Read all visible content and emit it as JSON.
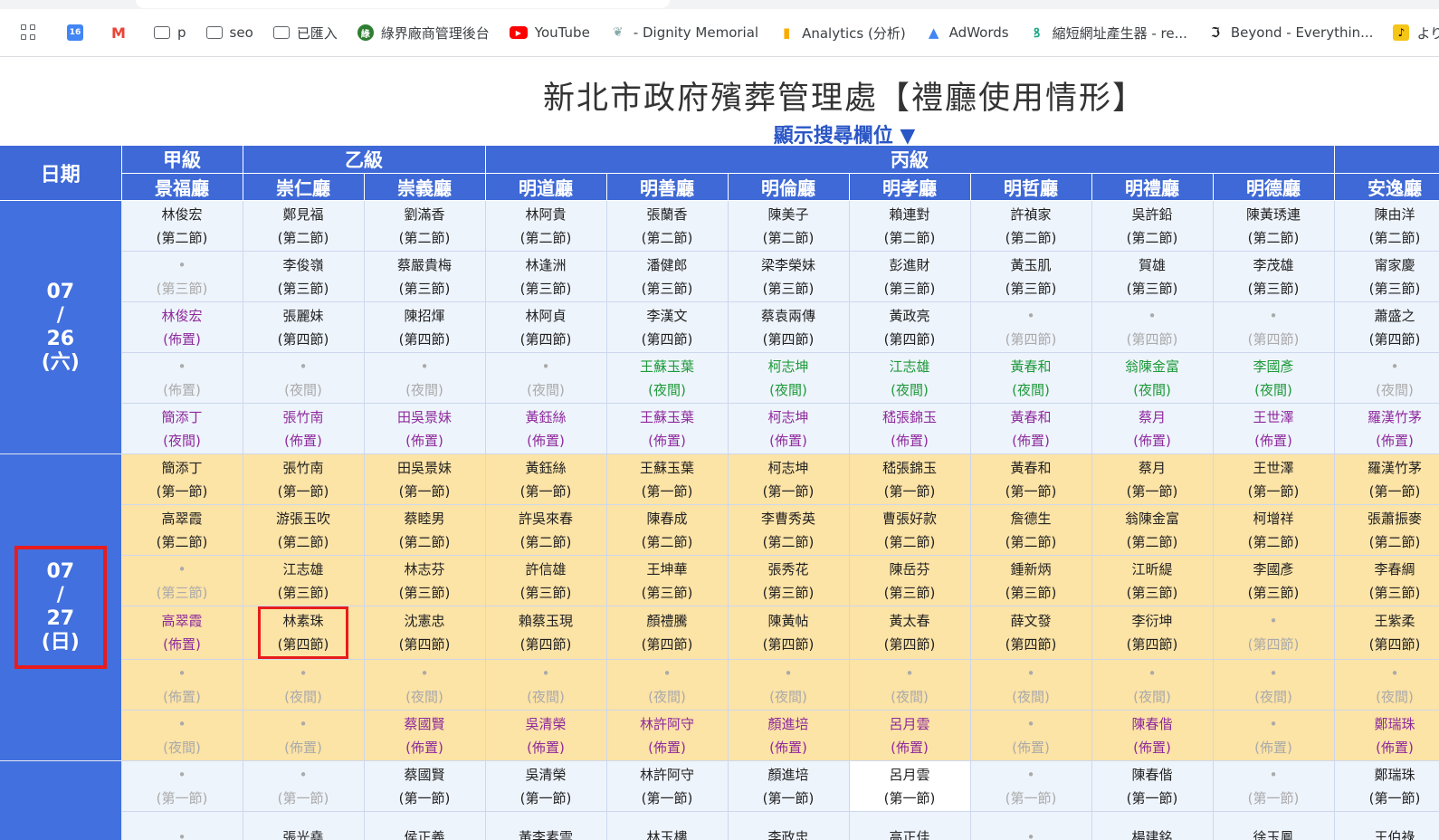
{
  "bookmarks": [
    {
      "label": "",
      "icon": "calendar-icon"
    },
    {
      "label": "",
      "icon": "gmail-icon"
    },
    {
      "label": "p",
      "icon": "folder-icon"
    },
    {
      "label": "seo",
      "icon": "folder-icon"
    },
    {
      "label": "已匯入",
      "icon": "folder-icon"
    },
    {
      "label": "綠界廠商管理後台",
      "icon": "ecpay-icon"
    },
    {
      "label": "YouTube",
      "icon": "youtube-icon"
    },
    {
      "label": "- Dignity Memorial",
      "icon": "leaf-icon"
    },
    {
      "label": "Analytics (分析)",
      "icon": "analytics-icon"
    },
    {
      "label": "AdWords",
      "icon": "adwords-icon"
    },
    {
      "label": "縮短網址產生器 - re...",
      "icon": "link-icon"
    },
    {
      "label": "Beyond - Everythin...",
      "icon": "beyond-icon"
    },
    {
      "label": "よりそ",
      "icon": "yorisou-icon"
    }
  ],
  "page": {
    "title": "新北市政府殯葬管理處【禮廳使用情形】",
    "search_toggle": "顯示搜尋欄位 ▼"
  },
  "table": {
    "date_header": "日期",
    "grades": [
      {
        "label": "甲級",
        "span": 1
      },
      {
        "label": "乙級",
        "span": 2
      },
      {
        "label": "丙級",
        "span": 7
      },
      {
        "label": "",
        "span": 1
      }
    ],
    "halls": [
      "景福廳",
      "崇仁廳",
      "崇義廳",
      "明道廳",
      "明善廳",
      "明倫廳",
      "明孝廳",
      "明哲廳",
      "明禮廳",
      "明德廳",
      "安逸廳"
    ],
    "days": [
      {
        "date_lines": [
          "07",
          "/",
          "26",
          "(六)"
        ],
        "theme": "blue",
        "rows": [
          [
            [
              "林俊宏",
              "(第二節)",
              "n"
            ],
            [
              "鄭見福",
              "(第二節)",
              "n"
            ],
            [
              "劉滿香",
              "(第二節)",
              "n"
            ],
            [
              "林阿貴",
              "(第二節)",
              "n"
            ],
            [
              "張蘭香",
              "(第二節)",
              "n"
            ],
            [
              "陳美子",
              "(第二節)",
              "n"
            ],
            [
              "賴連對",
              "(第二節)",
              "n"
            ],
            [
              "許禎家",
              "(第二節)",
              "n"
            ],
            [
              "吳許鉛",
              "(第二節)",
              "n"
            ],
            [
              "陳黃琇連",
              "(第二節)",
              "n"
            ],
            [
              "陳由洋",
              "(第二節)",
              "n"
            ]
          ],
          [
            [
              "•",
              "(第三節)",
              "e"
            ],
            [
              "李俊嶺",
              "(第三節)",
              "n"
            ],
            [
              "蔡嚴貴梅",
              "(第三節)",
              "n"
            ],
            [
              "林逢洲",
              "(第三節)",
              "n"
            ],
            [
              "潘健郎",
              "(第三節)",
              "n"
            ],
            [
              "梁李榮妹",
              "(第三節)",
              "n"
            ],
            [
              "彭進財",
              "(第三節)",
              "n"
            ],
            [
              "黃玉肌",
              "(第三節)",
              "n"
            ],
            [
              "賀雄",
              "(第三節)",
              "n"
            ],
            [
              "李茂雄",
              "(第三節)",
              "n"
            ],
            [
              "甯家慶",
              "(第三節)",
              "n"
            ]
          ],
          [
            [
              "林俊宏",
              "(佈置)",
              "p"
            ],
            [
              "張麗妹",
              "(第四節)",
              "n"
            ],
            [
              "陳招煇",
              "(第四節)",
              "n"
            ],
            [
              "林阿貞",
              "(第四節)",
              "n"
            ],
            [
              "李漢文",
              "(第四節)",
              "n"
            ],
            [
              "蔡袁兩傳",
              "(第四節)",
              "n"
            ],
            [
              "黃政亮",
              "(第四節)",
              "n"
            ],
            [
              "•",
              "(第四節)",
              "e"
            ],
            [
              "•",
              "(第四節)",
              "e"
            ],
            [
              "•",
              "(第四節)",
              "e"
            ],
            [
              "蕭盛之",
              "(第四節)",
              "n"
            ]
          ],
          [
            [
              "•",
              "(佈置)",
              "e"
            ],
            [
              "•",
              "(夜間)",
              "e"
            ],
            [
              "•",
              "(夜間)",
              "e"
            ],
            [
              "•",
              "(夜間)",
              "e"
            ],
            [
              "王蘇玉葉",
              "(夜間)",
              "g"
            ],
            [
              "柯志坤",
              "(夜間)",
              "g"
            ],
            [
              "江志雄",
              "(夜間)",
              "g"
            ],
            [
              "黃春和",
              "(夜間)",
              "g"
            ],
            [
              "翁陳金富",
              "(夜間)",
              "g"
            ],
            [
              "李國彥",
              "(夜間)",
              "g"
            ],
            [
              "•",
              "(夜間)",
              "e"
            ]
          ],
          [
            [
              "簡添丁",
              "(夜間)",
              "p"
            ],
            [
              "張竹南",
              "(佈置)",
              "p"
            ],
            [
              "田吳景妹",
              "(佈置)",
              "p"
            ],
            [
              "黃鈺絲",
              "(佈置)",
              "p"
            ],
            [
              "王蘇玉葉",
              "(佈置)",
              "p"
            ],
            [
              "柯志坤",
              "(佈置)",
              "p"
            ],
            [
              "嵇張錦玉",
              "(佈置)",
              "p"
            ],
            [
              "黃春和",
              "(佈置)",
              "p"
            ],
            [
              "蔡月",
              "(佈置)",
              "p"
            ],
            [
              "王世澤",
              "(佈置)",
              "p"
            ],
            [
              "羅漢竹茅",
              "(佈置)",
              "p"
            ]
          ]
        ]
      },
      {
        "date_lines": [
          "07",
          "/",
          "27",
          "(日)"
        ],
        "theme": "orange",
        "highlight_date": true,
        "rows": [
          [
            [
              "簡添丁",
              "(第一節)",
              "n"
            ],
            [
              "張竹南",
              "(第一節)",
              "n"
            ],
            [
              "田吳景妹",
              "(第一節)",
              "n"
            ],
            [
              "黃鈺絲",
              "(第一節)",
              "n"
            ],
            [
              "王蘇玉葉",
              "(第一節)",
              "n"
            ],
            [
              "柯志坤",
              "(第一節)",
              "n"
            ],
            [
              "嵇張錦玉",
              "(第一節)",
              "n"
            ],
            [
              "黃春和",
              "(第一節)",
              "n"
            ],
            [
              "蔡月",
              "(第一節)",
              "n"
            ],
            [
              "王世澤",
              "(第一節)",
              "n"
            ],
            [
              "羅漢竹茅",
              "(第一節)",
              "n"
            ]
          ],
          [
            [
              "高翠霞",
              "(第二節)",
              "n"
            ],
            [
              "游張玉吹",
              "(第二節)",
              "n"
            ],
            [
              "蔡睦男",
              "(第二節)",
              "n"
            ],
            [
              "許吳來春",
              "(第二節)",
              "n"
            ],
            [
              "陳春成",
              "(第二節)",
              "n"
            ],
            [
              "李曹秀英",
              "(第二節)",
              "n"
            ],
            [
              "曹張好款",
              "(第二節)",
              "n"
            ],
            [
              "詹德生",
              "(第二節)",
              "n"
            ],
            [
              "翁陳金富",
              "(第二節)",
              "n"
            ],
            [
              "柯增祥",
              "(第二節)",
              "n"
            ],
            [
              "張蕭振麥",
              "(第二節)",
              "n"
            ]
          ],
          [
            [
              "•",
              "(第三節)",
              "e"
            ],
            [
              "江志雄",
              "(第三節)",
              "n"
            ],
            [
              "林志芬",
              "(第三節)",
              "n"
            ],
            [
              "許信雄",
              "(第三節)",
              "n"
            ],
            [
              "王坤華",
              "(第三節)",
              "n"
            ],
            [
              "張秀花",
              "(第三節)",
              "n"
            ],
            [
              "陳岳芬",
              "(第三節)",
              "n"
            ],
            [
              "鍾新炳",
              "(第三節)",
              "n"
            ],
            [
              "江昕緹",
              "(第三節)",
              "n"
            ],
            [
              "李國彥",
              "(第三節)",
              "n"
            ],
            [
              "李春綢",
              "(第三節)",
              "n"
            ]
          ],
          [
            [
              "高翠霞",
              "(佈置)",
              "p"
            ],
            [
              "林素珠",
              "(第四節)",
              "n",
              "hl"
            ],
            [
              "沈憲忠",
              "(第四節)",
              "n"
            ],
            [
              "賴蔡玉現",
              "(第四節)",
              "n"
            ],
            [
              "顏禮騰",
              "(第四節)",
              "n"
            ],
            [
              "陳黃帖",
              "(第四節)",
              "n"
            ],
            [
              "黃太春",
              "(第四節)",
              "n"
            ],
            [
              "薛文發",
              "(第四節)",
              "n"
            ],
            [
              "李衍坤",
              "(第四節)",
              "n"
            ],
            [
              "•",
              "(第四節)",
              "e"
            ],
            [
              "王紫柔",
              "(第四節)",
              "n"
            ]
          ],
          [
            [
              "•",
              "(佈置)",
              "e"
            ],
            [
              "•",
              "(夜間)",
              "e"
            ],
            [
              "•",
              "(夜間)",
              "e"
            ],
            [
              "•",
              "(夜間)",
              "e"
            ],
            [
              "•",
              "(夜間)",
              "e"
            ],
            [
              "•",
              "(夜間)",
              "e"
            ],
            [
              "•",
              "(夜間)",
              "e"
            ],
            [
              "•",
              "(夜間)",
              "e"
            ],
            [
              "•",
              "(夜間)",
              "e"
            ],
            [
              "•",
              "(夜間)",
              "e"
            ],
            [
              "•",
              "(夜間)",
              "e"
            ]
          ],
          [
            [
              "•",
              "(夜間)",
              "e"
            ],
            [
              "•",
              "(佈置)",
              "e"
            ],
            [
              "蔡國賢",
              "(佈置)",
              "p"
            ],
            [
              "吳清榮",
              "(佈置)",
              "p"
            ],
            [
              "林許阿守",
              "(佈置)",
              "p"
            ],
            [
              "顏進培",
              "(佈置)",
              "p"
            ],
            [
              "呂月雲",
              "(佈置)",
              "p"
            ],
            [
              "•",
              "(佈置)",
              "e"
            ],
            [
              "陳春偕",
              "(佈置)",
              "p"
            ],
            [
              "•",
              "(佈置)",
              "e"
            ],
            [
              "鄭瑞珠",
              "(佈置)",
              "p"
            ]
          ]
        ]
      },
      {
        "date_lines": [
          "",
          "",
          "",
          ""
        ],
        "theme": "blue",
        "rows": [
          [
            [
              "•",
              "(第一節)",
              "e"
            ],
            [
              "•",
              "(第一節)",
              "e"
            ],
            [
              "蔡國賢",
              "(第一節)",
              "n"
            ],
            [
              "吳清榮",
              "(第一節)",
              "n"
            ],
            [
              "林許阿守",
              "(第一節)",
              "n"
            ],
            [
              "顏進培",
              "(第一節)",
              "n"
            ],
            [
              "呂月雲",
              "(第一節)",
              "n",
              "white"
            ],
            [
              "•",
              "(第一節)",
              "e"
            ],
            [
              "陳春偕",
              "(第一節)",
              "n"
            ],
            [
              "•",
              "(第一節)",
              "e"
            ],
            [
              "鄭瑞珠",
              "(第一節)",
              "n"
            ]
          ],
          [
            [
              "•",
              "",
              "e"
            ],
            [
              "張光堯",
              "",
              "n"
            ],
            [
              "侯正義",
              "",
              "n"
            ],
            [
              "黃李素雲",
              "",
              "n"
            ],
            [
              "林玉樓",
              "",
              "n"
            ],
            [
              "李政忠",
              "",
              "n"
            ],
            [
              "高正佳",
              "",
              "n"
            ],
            [
              "•",
              "",
              "e"
            ],
            [
              "楊建銘",
              "",
              "n"
            ],
            [
              "徐玉鳳",
              "",
              "n"
            ],
            [
              "王伯祿",
              "",
              "n"
            ]
          ]
        ]
      }
    ]
  }
}
